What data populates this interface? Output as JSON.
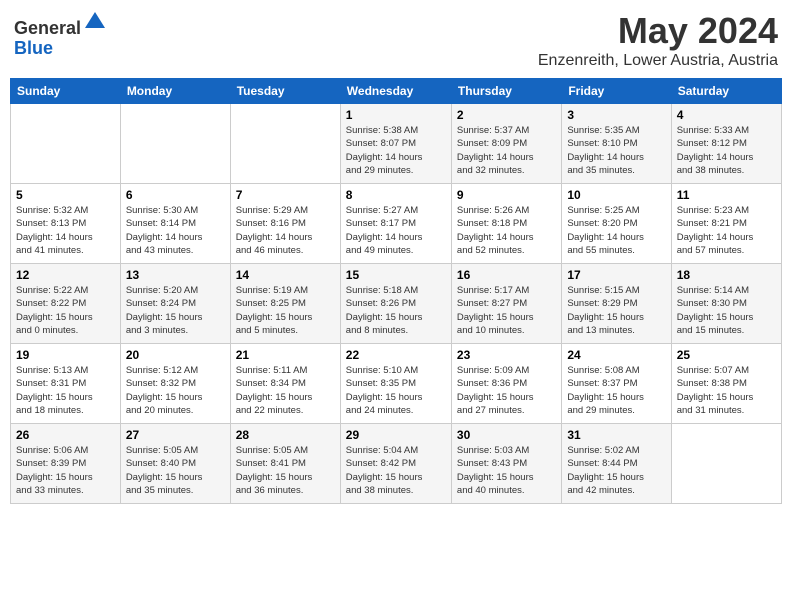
{
  "header": {
    "logo_general": "General",
    "logo_blue": "Blue",
    "month": "May 2024",
    "location": "Enzenreith, Lower Austria, Austria"
  },
  "days_of_week": [
    "Sunday",
    "Monday",
    "Tuesday",
    "Wednesday",
    "Thursday",
    "Friday",
    "Saturday"
  ],
  "weeks": [
    {
      "days": [
        {
          "number": "",
          "info": ""
        },
        {
          "number": "",
          "info": ""
        },
        {
          "number": "",
          "info": ""
        },
        {
          "number": "1",
          "info": "Sunrise: 5:38 AM\nSunset: 8:07 PM\nDaylight: 14 hours\nand 29 minutes."
        },
        {
          "number": "2",
          "info": "Sunrise: 5:37 AM\nSunset: 8:09 PM\nDaylight: 14 hours\nand 32 minutes."
        },
        {
          "number": "3",
          "info": "Sunrise: 5:35 AM\nSunset: 8:10 PM\nDaylight: 14 hours\nand 35 minutes."
        },
        {
          "number": "4",
          "info": "Sunrise: 5:33 AM\nSunset: 8:12 PM\nDaylight: 14 hours\nand 38 minutes."
        }
      ]
    },
    {
      "days": [
        {
          "number": "5",
          "info": "Sunrise: 5:32 AM\nSunset: 8:13 PM\nDaylight: 14 hours\nand 41 minutes."
        },
        {
          "number": "6",
          "info": "Sunrise: 5:30 AM\nSunset: 8:14 PM\nDaylight: 14 hours\nand 43 minutes."
        },
        {
          "number": "7",
          "info": "Sunrise: 5:29 AM\nSunset: 8:16 PM\nDaylight: 14 hours\nand 46 minutes."
        },
        {
          "number": "8",
          "info": "Sunrise: 5:27 AM\nSunset: 8:17 PM\nDaylight: 14 hours\nand 49 minutes."
        },
        {
          "number": "9",
          "info": "Sunrise: 5:26 AM\nSunset: 8:18 PM\nDaylight: 14 hours\nand 52 minutes."
        },
        {
          "number": "10",
          "info": "Sunrise: 5:25 AM\nSunset: 8:20 PM\nDaylight: 14 hours\nand 55 minutes."
        },
        {
          "number": "11",
          "info": "Sunrise: 5:23 AM\nSunset: 8:21 PM\nDaylight: 14 hours\nand 57 minutes."
        }
      ]
    },
    {
      "days": [
        {
          "number": "12",
          "info": "Sunrise: 5:22 AM\nSunset: 8:22 PM\nDaylight: 15 hours\nand 0 minutes."
        },
        {
          "number": "13",
          "info": "Sunrise: 5:20 AM\nSunset: 8:24 PM\nDaylight: 15 hours\nand 3 minutes."
        },
        {
          "number": "14",
          "info": "Sunrise: 5:19 AM\nSunset: 8:25 PM\nDaylight: 15 hours\nand 5 minutes."
        },
        {
          "number": "15",
          "info": "Sunrise: 5:18 AM\nSunset: 8:26 PM\nDaylight: 15 hours\nand 8 minutes."
        },
        {
          "number": "16",
          "info": "Sunrise: 5:17 AM\nSunset: 8:27 PM\nDaylight: 15 hours\nand 10 minutes."
        },
        {
          "number": "17",
          "info": "Sunrise: 5:15 AM\nSunset: 8:29 PM\nDaylight: 15 hours\nand 13 minutes."
        },
        {
          "number": "18",
          "info": "Sunrise: 5:14 AM\nSunset: 8:30 PM\nDaylight: 15 hours\nand 15 minutes."
        }
      ]
    },
    {
      "days": [
        {
          "number": "19",
          "info": "Sunrise: 5:13 AM\nSunset: 8:31 PM\nDaylight: 15 hours\nand 18 minutes."
        },
        {
          "number": "20",
          "info": "Sunrise: 5:12 AM\nSunset: 8:32 PM\nDaylight: 15 hours\nand 20 minutes."
        },
        {
          "number": "21",
          "info": "Sunrise: 5:11 AM\nSunset: 8:34 PM\nDaylight: 15 hours\nand 22 minutes."
        },
        {
          "number": "22",
          "info": "Sunrise: 5:10 AM\nSunset: 8:35 PM\nDaylight: 15 hours\nand 24 minutes."
        },
        {
          "number": "23",
          "info": "Sunrise: 5:09 AM\nSunset: 8:36 PM\nDaylight: 15 hours\nand 27 minutes."
        },
        {
          "number": "24",
          "info": "Sunrise: 5:08 AM\nSunset: 8:37 PM\nDaylight: 15 hours\nand 29 minutes."
        },
        {
          "number": "25",
          "info": "Sunrise: 5:07 AM\nSunset: 8:38 PM\nDaylight: 15 hours\nand 31 minutes."
        }
      ]
    },
    {
      "days": [
        {
          "number": "26",
          "info": "Sunrise: 5:06 AM\nSunset: 8:39 PM\nDaylight: 15 hours\nand 33 minutes."
        },
        {
          "number": "27",
          "info": "Sunrise: 5:05 AM\nSunset: 8:40 PM\nDaylight: 15 hours\nand 35 minutes."
        },
        {
          "number": "28",
          "info": "Sunrise: 5:05 AM\nSunset: 8:41 PM\nDaylight: 15 hours\nand 36 minutes."
        },
        {
          "number": "29",
          "info": "Sunrise: 5:04 AM\nSunset: 8:42 PM\nDaylight: 15 hours\nand 38 minutes."
        },
        {
          "number": "30",
          "info": "Sunrise: 5:03 AM\nSunset: 8:43 PM\nDaylight: 15 hours\nand 40 minutes."
        },
        {
          "number": "31",
          "info": "Sunrise: 5:02 AM\nSunset: 8:44 PM\nDaylight: 15 hours\nand 42 minutes."
        },
        {
          "number": "",
          "info": ""
        }
      ]
    }
  ]
}
